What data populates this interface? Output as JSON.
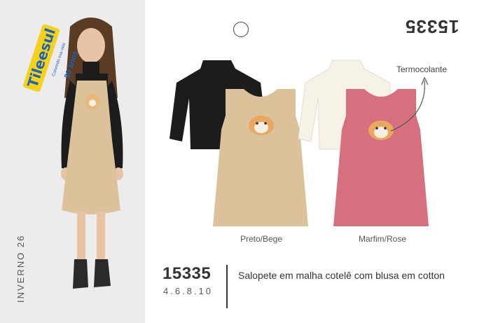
{
  "product": {
    "code": "15335",
    "code_mirrored": "15335",
    "sizes": "4.6.8.10",
    "description": "Salopete em malha cotelê com blusa em cotton"
  },
  "collection": {
    "season": "INVERNO 26"
  },
  "brand": {
    "name": "Tileesul",
    "tagline": "Colorindo sua vida",
    "anniversary": "30 anos"
  },
  "callout": {
    "label": "Termocolante"
  },
  "variants": [
    {
      "caption": "Preto/Bege",
      "top_color": "#1c1c1e",
      "dress_color": "#dcc29a"
    },
    {
      "caption": "Marfim/Rose",
      "top_color": "#f6f2e8",
      "dress_color": "#d6707f"
    }
  ],
  "colors": {
    "panel_bg": "#ececec",
    "brand_blue": "#1e63b8",
    "brand_yellow": "#f4d21a"
  }
}
